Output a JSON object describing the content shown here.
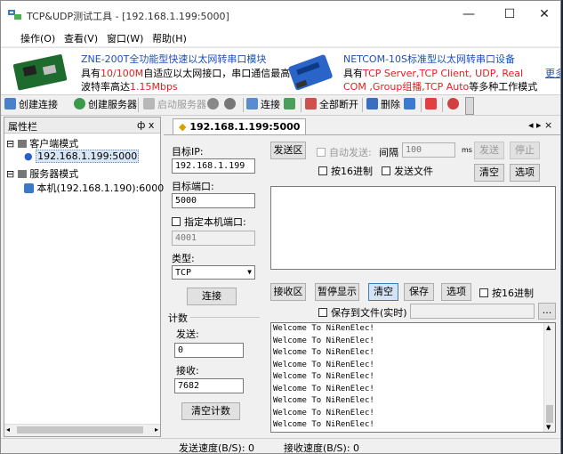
{
  "window": {
    "title": "TCP&UDP测试工具 - [192.168.1.199:5000]"
  },
  "menu": [
    "操作(O)",
    "查看(V)",
    "窗口(W)",
    "帮助(H)"
  ],
  "ad": {
    "left": {
      "line1": "ZNE-200T全功能型快速以太网转串口模块",
      "line2a": "具有",
      "line2b": "10/100M",
      "line2c": "自适应以太网接口，串口通信最高",
      "line3a": "波特率高达",
      "line3b": "1.15Mbps"
    },
    "right": {
      "line1": "NETCOM-10S标准型以太网转串口设备",
      "line2a": "具有",
      "line2b": "TCP Server,TCP Client, UDP, Real",
      "line3a": "COM ,Group组播,TCP Auto",
      "line3b": "等多种工作模式"
    },
    "more": "更多"
  },
  "toolbar": {
    "create_conn": "创建连接",
    "create_server": "创建服务器",
    "start_server": "启动服务器",
    "connect": "连接",
    "disconnect_all": "全部断开",
    "delete": "删除"
  },
  "left_panel": {
    "title": "属性栏",
    "pin": "ф x",
    "client_mode": "客户端模式",
    "client_item": "192.168.1.199:5000",
    "server_mode": "服务器模式",
    "server_item": "本机(192.168.1.190):6000"
  },
  "tab": {
    "label": "192.168.1.199:5000",
    "nav": "◂ ▸ ×"
  },
  "conn": {
    "target_ip_label": "目标IP:",
    "target_ip": "192.168.1.199",
    "target_port_label": "目标端口:",
    "target_port": "5000",
    "local_port_label": "指定本机端口:",
    "local_port": "4001",
    "type_label": "类型:",
    "type": "TCP",
    "connect_btn": "连接",
    "count_label": "计数",
    "send_label": "发送:",
    "send_count": "0",
    "recv_label": "接收:",
    "recv_count": "7682",
    "clear_count_btn": "清空计数"
  },
  "send": {
    "area_btn": "发送区",
    "auto_send": "自动发送:",
    "interval_label": "间隔",
    "interval": "100",
    "unit": "ms",
    "send_btn": "发送",
    "stop_btn": "停止",
    "hex": "按16进制",
    "send_file": "发送文件",
    "clear_btn": "清空",
    "options_btn": "选项"
  },
  "recv": {
    "area_btn": "接收区",
    "pause_btn": "暂停显示",
    "clear_btn": "清空",
    "save_btn": "保存",
    "options_btn": "选项",
    "hex": "按16进制",
    "save_file": "保存到文件(实时)",
    "browse": "...",
    "lines": [
      "Welcome To NiRenElec!",
      "Welcome To NiRenElec!",
      "Welcome To NiRenElec!",
      "Welcome To NiRenElec!",
      "Welcome To NiRenElec!",
      "Welcome To NiRenElec!",
      "Welcome To NiRenElec!",
      "Welcome To NiRenElec!",
      "Welcome To NiRenElec!"
    ]
  },
  "status": {
    "send_speed": "发送速度(B/S): 0",
    "recv_speed": "接收速度(B/S): 0"
  },
  "colors": {
    "accent_red": "#e02020",
    "link_blue": "#1d4fb8"
  }
}
